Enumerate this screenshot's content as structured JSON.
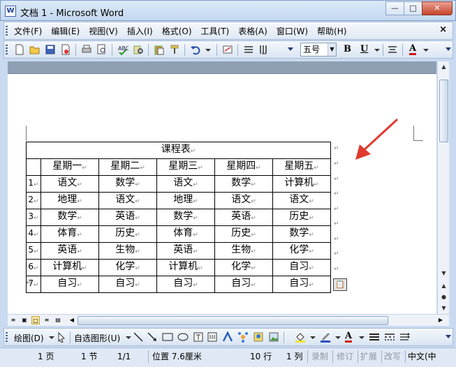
{
  "window": {
    "title": "文档 1 - Microsoft Word",
    "app_icon": "W"
  },
  "menu": {
    "items": [
      "文件(F)",
      "编辑(E)",
      "视图(V)",
      "插入(I)",
      "格式(O)",
      "工具(T)",
      "表格(A)",
      "窗口(W)",
      "帮助(H)"
    ],
    "close": "×"
  },
  "toolbar": {
    "font_size": "五号",
    "bold": "B",
    "underline": "U",
    "font_color": "A"
  },
  "table": {
    "title": "课程表",
    "headers": [
      "星期一",
      "星期二",
      "星期三",
      "星期四",
      "星期五"
    ],
    "rows": [
      {
        "num": "1",
        "cells": [
          "语文",
          "数学",
          "语文",
          "数学",
          "计算机"
        ]
      },
      {
        "num": "2",
        "cells": [
          "地理",
          "语文",
          "地理",
          "语文",
          "语文"
        ]
      },
      {
        "num": "3",
        "cells": [
          "数学",
          "英语",
          "数学",
          "英语",
          "历史"
        ]
      },
      {
        "num": "4",
        "cells": [
          "体育",
          "历史",
          "体育",
          "历史",
          "数学"
        ]
      },
      {
        "num": "5",
        "cells": [
          "英语",
          "生物",
          "英语",
          "生物",
          "化学"
        ]
      },
      {
        "num": "6",
        "cells": [
          "计算机",
          "化学",
          "计算机",
          "化学",
          "自习"
        ]
      },
      {
        "num": "7",
        "cells": [
          "自习",
          "自习",
          "自习",
          "自习",
          "自习"
        ]
      }
    ]
  },
  "drawbar": {
    "draw": "绘图(D)",
    "autoshapes": "自选图形(U)"
  },
  "status": {
    "page": "1 页",
    "section": "1 节",
    "pages": "1/1",
    "position": "位置 7.6厘米",
    "line": "10 行",
    "col": "1 列",
    "rec": "录制",
    "trk": "修订",
    "ext": "扩展",
    "ovr": "改写",
    "lang": "中文(中"
  },
  "colors": {
    "arrow": "#e03a2f",
    "title_bar": "#c4d8f0"
  }
}
